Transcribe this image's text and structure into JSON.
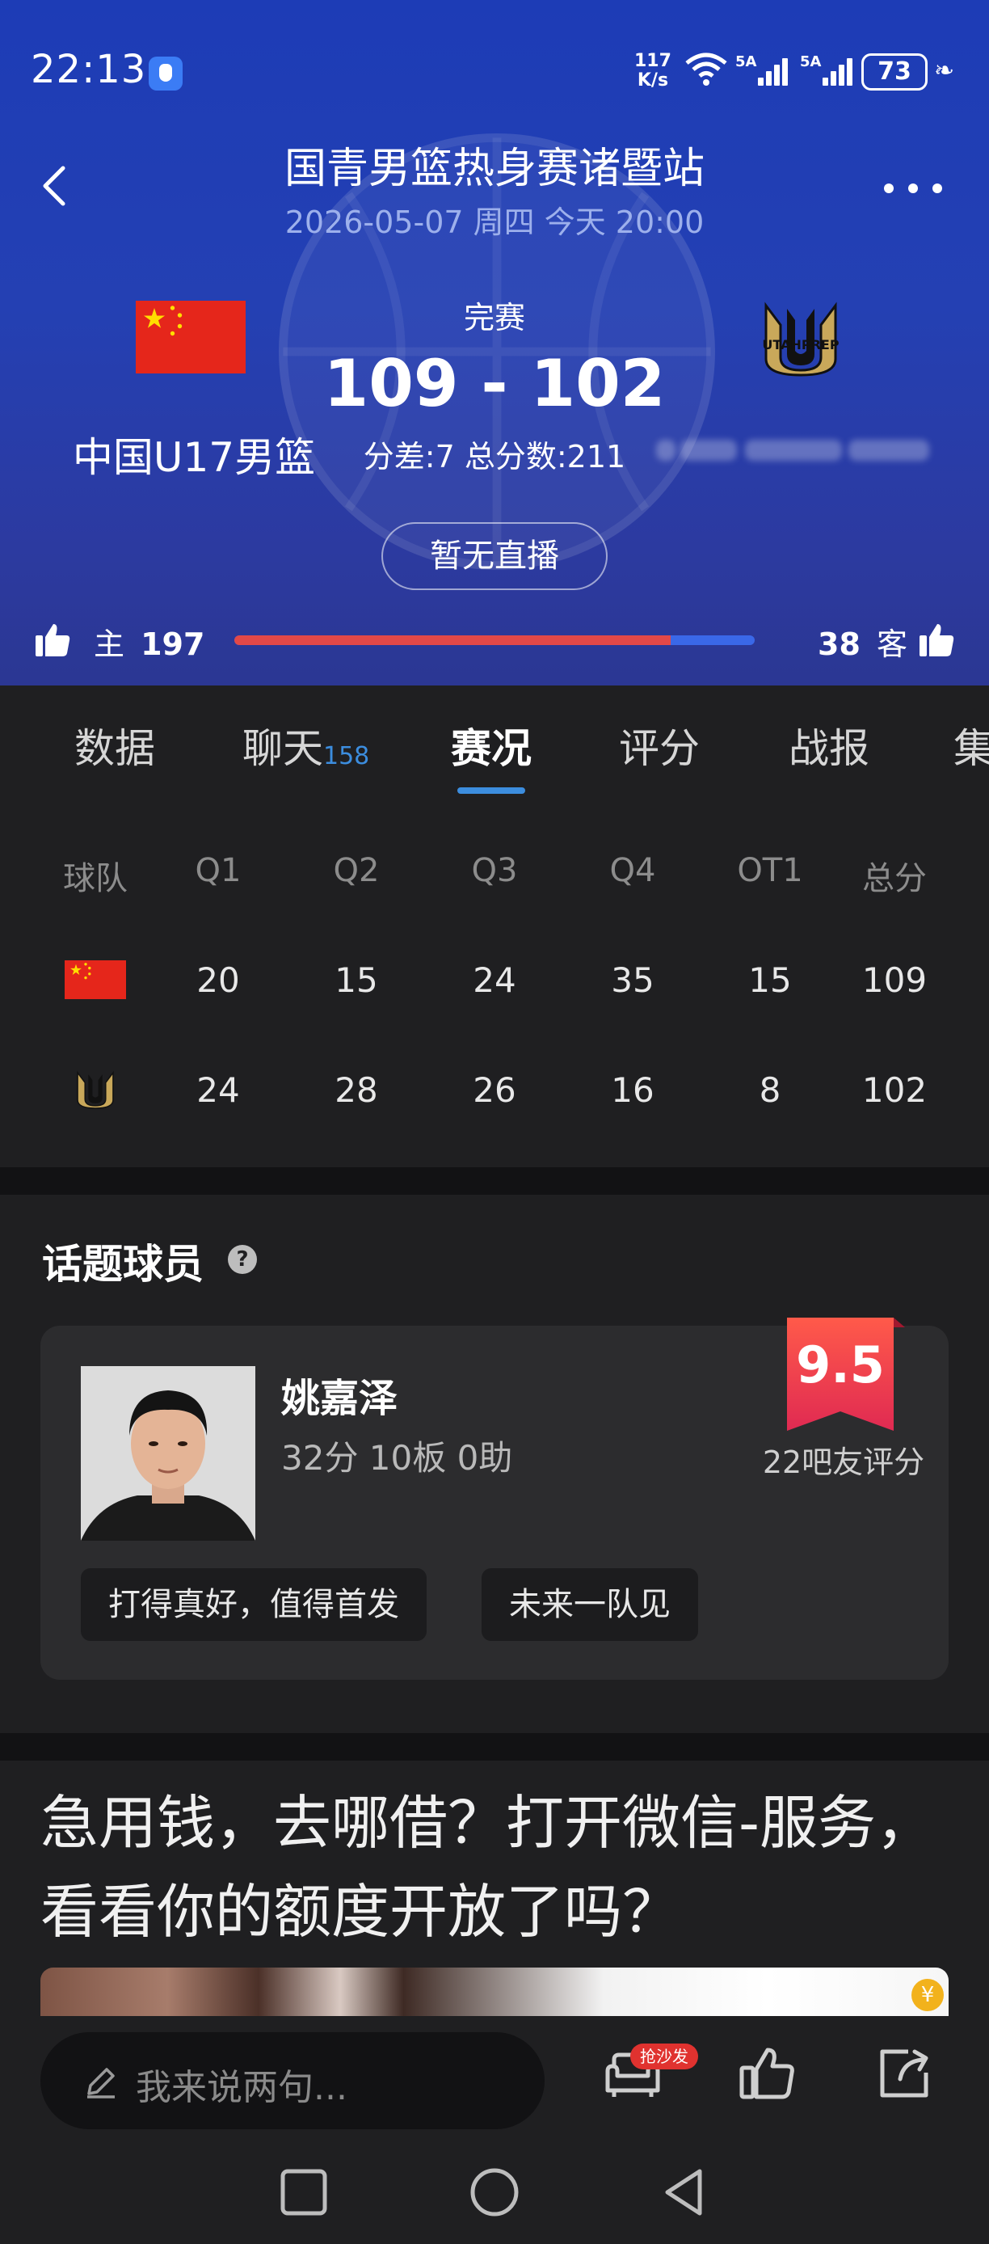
{
  "status_bar": {
    "time": "22:13",
    "net_speed_value": "117",
    "net_speed_unit": "K/s",
    "wifi_label": "6",
    "sim1": "5A",
    "sim2": "5A",
    "battery": "73"
  },
  "header": {
    "title": "国青男篮热身赛诸暨站",
    "datetime": "2026-05-07 周四 今天 20:00",
    "status": "完赛",
    "score": "109 - 102",
    "score_meta": "分差:7 总分数:211",
    "home_team": "中国U17男篮",
    "away_logo_text": "UTAHPREP",
    "live_button": "暂无直播",
    "vote_home_label": "主",
    "vote_home_count": "197",
    "vote_away_label": "客",
    "vote_away_count": "38",
    "vote_home_fraction": 0.838
  },
  "tabs": [
    {
      "label": "数据"
    },
    {
      "label": "聊天",
      "badge": "158"
    },
    {
      "label": "赛况"
    },
    {
      "label": "评分"
    },
    {
      "label": "战报"
    },
    {
      "label": "集"
    }
  ],
  "quarter_table": {
    "headers": [
      "球队",
      "Q1",
      "Q2",
      "Q3",
      "Q4",
      "OT1",
      "总分"
    ],
    "rows": [
      {
        "team": "home",
        "values": [
          "20",
          "15",
          "24",
          "35",
          "15",
          "109"
        ]
      },
      {
        "team": "away",
        "values": [
          "24",
          "28",
          "26",
          "16",
          "8",
          "102"
        ]
      }
    ]
  },
  "hot_players": {
    "title": "话题球员",
    "help": "?",
    "player": {
      "name": "姚嘉泽",
      "stats": "32分 10板 0助",
      "rating": "9.5",
      "rating_count": "22吧友评分",
      "comments": [
        "打得真好，值得首发",
        "未来一队见"
      ]
    }
  },
  "ad": {
    "text": "急用钱，去哪借？打开微信-服务，看看你的额度开放了吗？"
  },
  "bottom_bar": {
    "placeholder": "我来说两句...",
    "sofa_badge": "抢沙发"
  },
  "colors": {
    "accent_blue": "#3c8dde",
    "home_red": "#e24848",
    "away_blue": "#3a68e8",
    "rating_red": "#e8384a"
  }
}
